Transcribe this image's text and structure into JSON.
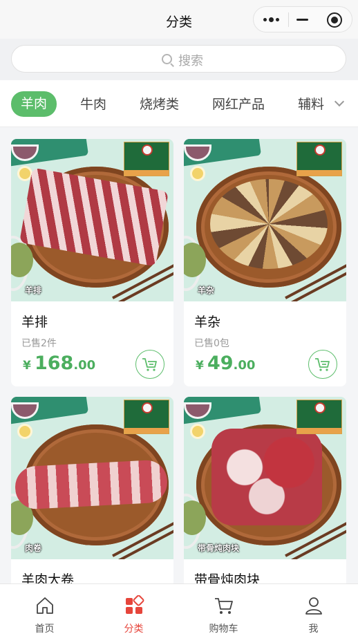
{
  "header": {
    "title": "分类"
  },
  "search": {
    "placeholder": "搜索"
  },
  "categories": {
    "tabs": [
      {
        "label": "羊肉",
        "active": true
      },
      {
        "label": "牛肉"
      },
      {
        "label": "烧烤类"
      },
      {
        "label": "网红产品"
      },
      {
        "label": "辅料"
      }
    ]
  },
  "products": [
    {
      "name": "羊排",
      "image_tag": "羊排",
      "sold": "已售2件",
      "currency": "¥",
      "price_int": "168",
      "price_dec": ".00"
    },
    {
      "name": "羊杂",
      "image_tag": "羊杂",
      "sold": "已售0包",
      "currency": "¥",
      "price_int": "49",
      "price_dec": ".00"
    },
    {
      "name": "羊肉大卷",
      "image_tag": "肉卷"
    },
    {
      "name": "带骨炖肉块",
      "image_tag": "带骨炖肉块"
    }
  ],
  "tabbar": {
    "items": [
      {
        "label": "首页",
        "icon": "home-icon"
      },
      {
        "label": "分类",
        "icon": "category-icon",
        "active": true
      },
      {
        "label": "购物车",
        "icon": "cart-icon"
      },
      {
        "label": "我",
        "icon": "user-icon"
      }
    ]
  },
  "colors": {
    "accent": "#5cbd6b",
    "tab_active": "#e6453b",
    "price": "#4bae5e"
  }
}
